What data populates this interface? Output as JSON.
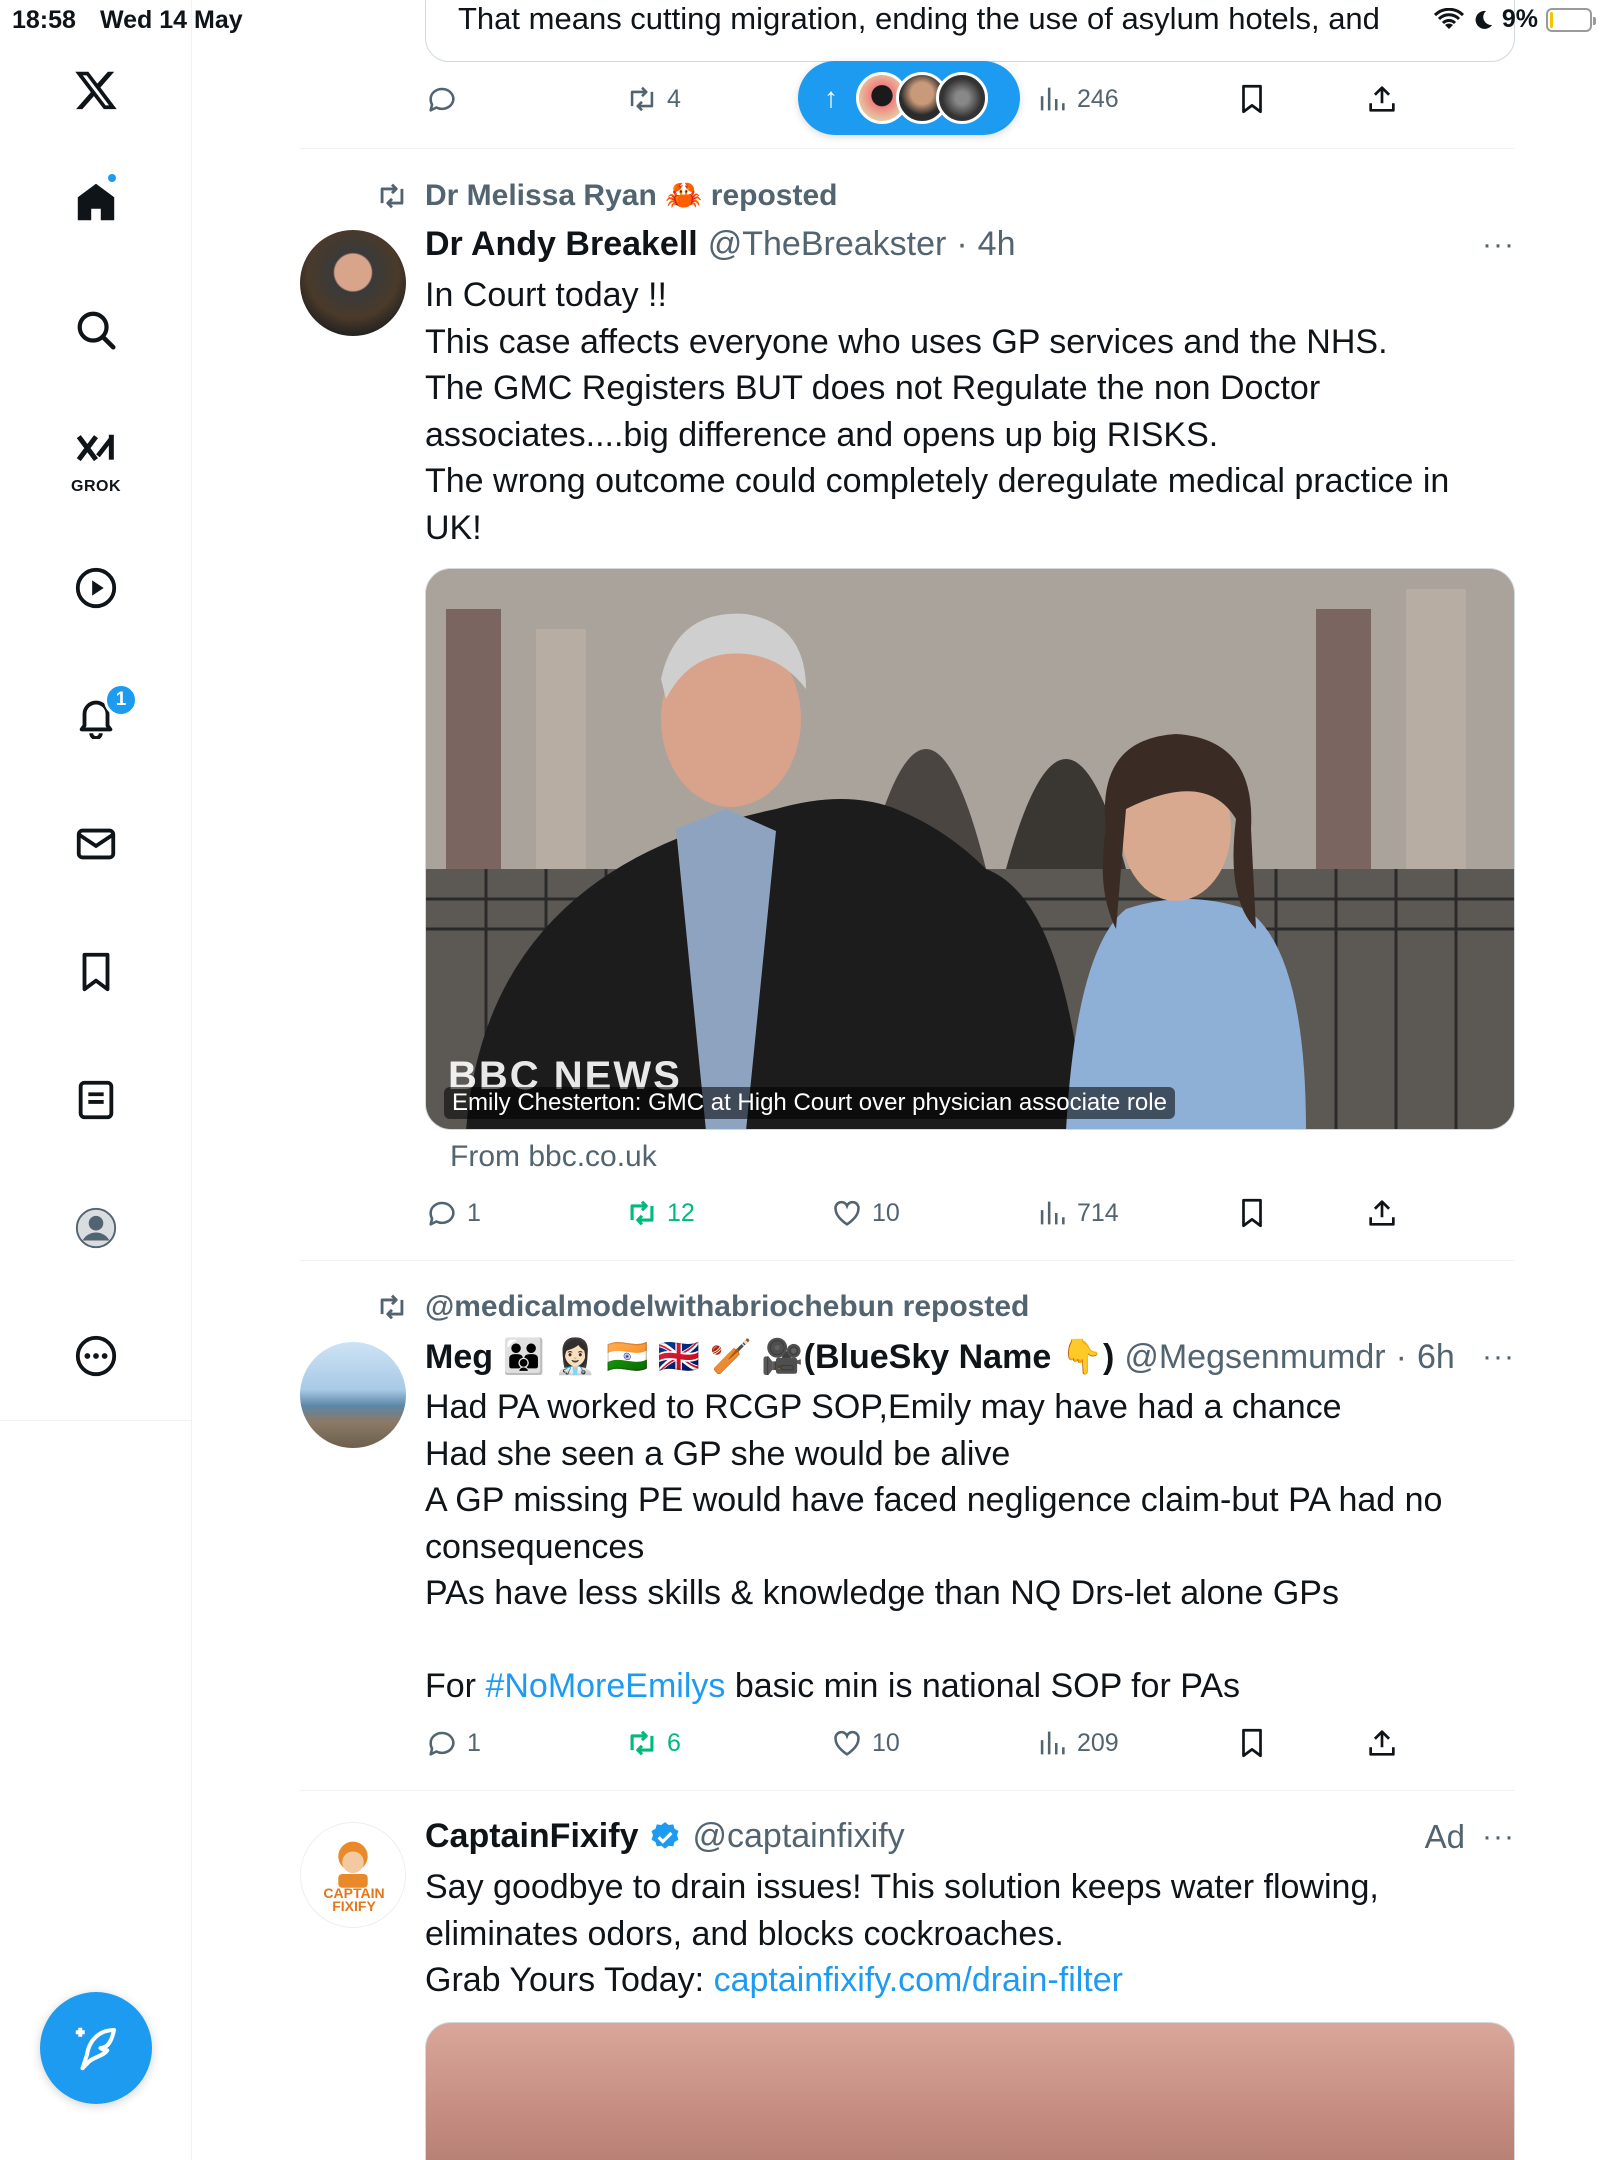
{
  "status": {
    "time": "18:58",
    "date": "Wed 14 May",
    "battery": "9%",
    "battery_level": 0.09
  },
  "sidebar": {
    "notification_count": "1",
    "grok_label": "GROK"
  },
  "top_tweet": {
    "quote_text": "That means cutting migration, ending the use of asylum hotels, and",
    "retweets": "4",
    "views": "246"
  },
  "tweet1": {
    "reposted_by": "Dr Melissa Ryan 🦀 reposted",
    "name": "Dr Andy Breakell",
    "handle": "@TheBreakster",
    "time": "4h",
    "lines": [
      "In Court today !!",
      "This case affects everyone who uses GP services and the NHS.",
      "The GMC Registers BUT does not Regulate the non Doctor",
      "associates....big difference and opens up big RISKS.",
      "The wrong outcome could completely deregulate medical practice in",
      "UK!"
    ],
    "media_caption": "Emily Chesterton: GMC at High Court over physician associate role",
    "media_watermark": "BBC NEWS",
    "source": "From bbc.co.uk",
    "replies": "1",
    "retweets": "12",
    "likes": "10",
    "views": "714"
  },
  "tweet2": {
    "reposted_by": "@medicalmodelwithabriochebun reposted",
    "name": "Meg 🧑‍🧑‍🧒 👩🏻‍⚕️ 🇮🇳 🇬🇧 🏏 🎥(BlueSky Name 👇)",
    "handle": "@Megsenmumdr",
    "time": "6h",
    "lines": [
      "Had PA worked to RCGP SOP,Emily may have had a chance",
      "Had she seen a GP she would be alive",
      "A GP missing PE would have faced negligence claim-but PA had no",
      "consequences",
      "PAs have less skills & knowledge than NQ Drs-let alone GPs"
    ],
    "last_line_prefix": "For ",
    "hashtag": "#NoMoreEmilys",
    "last_line_suffix": " basic min is national SOP for PAs",
    "replies": "1",
    "retweets": "6",
    "likes": "10",
    "views": "209"
  },
  "tweet3": {
    "name": "CaptainFixify",
    "handle": "@captainfixify",
    "ad_label": "Ad",
    "lines": [
      "Say goodbye to drain issues! This solution keeps water flowing,",
      "eliminates odors, and blocks cockroaches."
    ],
    "cta_prefix": "Grab Yours Today: ",
    "link": "captainfixify.com/drain-filter",
    "logo_text": "CAPTAIN FIXIFY"
  },
  "icons": [
    "x-logo-icon",
    "home-icon",
    "search-icon",
    "grok-icon",
    "video-icon",
    "bell-icon",
    "mail-icon",
    "bookmark-icon",
    "list-icon",
    "profile-icon",
    "more-icon",
    "compose-icon",
    "reply-icon",
    "retweet-icon",
    "like-icon",
    "views-icon",
    "share-icon"
  ],
  "colors": {
    "accent": "#1d9bf0",
    "retweet_green": "#00ba7c",
    "muted": "#536471"
  }
}
